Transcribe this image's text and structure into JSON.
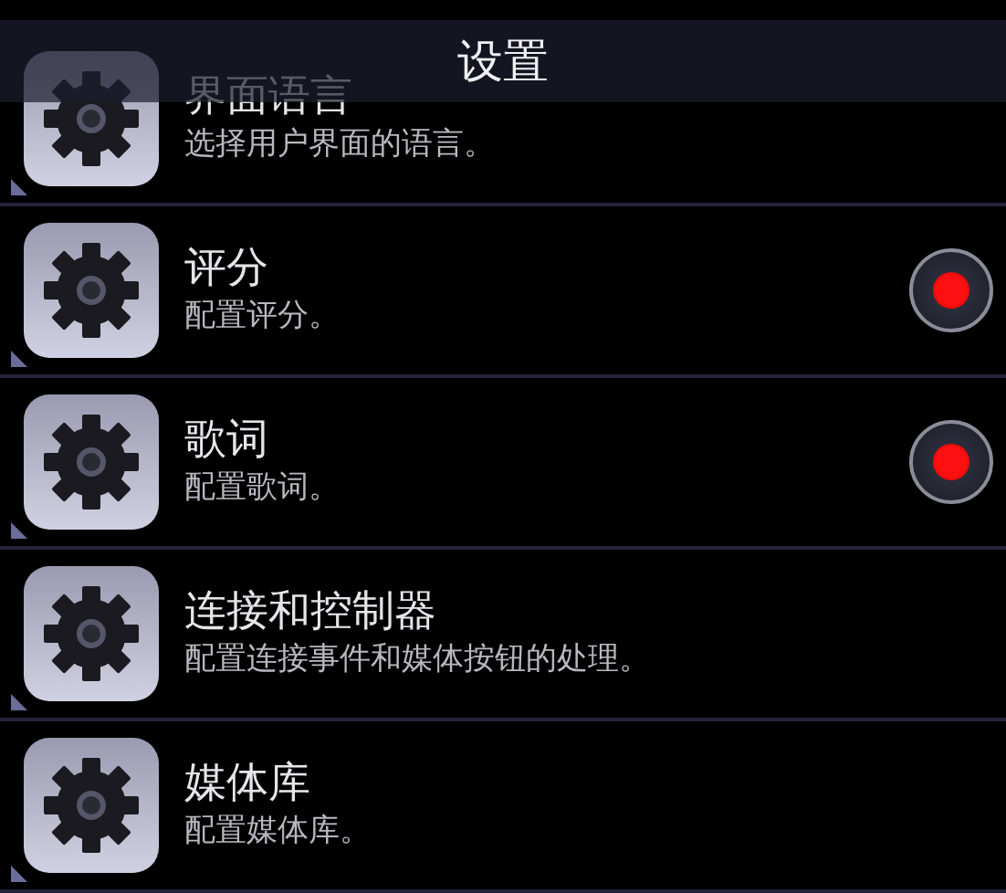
{
  "header": {
    "title": "设置"
  },
  "items": [
    {
      "kind": "plain",
      "title": "界面语言",
      "subtitle": "选择用户界面的语言。"
    },
    {
      "kind": "toggle",
      "title": "评分",
      "subtitle": "配置评分。",
      "on": true
    },
    {
      "kind": "toggle",
      "title": "歌词",
      "subtitle": "配置歌词。",
      "on": true
    },
    {
      "kind": "plain",
      "title": "连接和控制器",
      "subtitle": "配置连接事件和媒体按钮的处理。"
    },
    {
      "kind": "plain",
      "title": "媒体库",
      "subtitle": "配置媒体库。"
    }
  ]
}
